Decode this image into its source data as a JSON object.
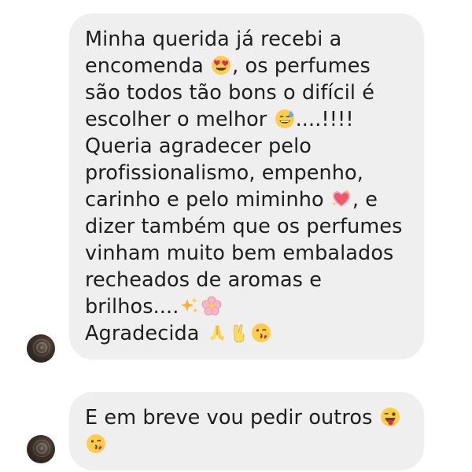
{
  "thread": {
    "messages": [
      {
        "lines": [
          [
            "Minha querida já recebi a"
          ],
          [
            "encomenda ",
            {
              "emoji": "heart-eyes-emoji"
            },
            ", os perfumes"
          ],
          [
            "são todos tão bons o difícil é"
          ],
          [
            "escolher o melhor ",
            {
              "emoji": "sweat-smile-emoji"
            },
            "....!!!!"
          ],
          [
            "Queria agradecer pelo"
          ],
          [
            "profissionalismo, empenho,"
          ],
          [
            "carinho e pelo miminho ",
            {
              "emoji": "sparkling-heart-emoji"
            },
            ", e"
          ],
          [
            "dizer também que os perfumes"
          ],
          [
            "vinham muito bem embalados"
          ],
          [
            "recheados de aromas e"
          ],
          [
            "brilhos....",
            {
              "emoji": "sparkles-emoji"
            },
            {
              "emoji": "cherry-blossom-emoji"
            }
          ],
          [
            "Agradecida ",
            {
              "emoji": "folded-hands-emoji"
            },
            {
              "emoji": "victory-hand-emoji"
            },
            {
              "emoji": "kissing-wink-emoji"
            }
          ]
        ]
      },
      {
        "lines": [
          [
            "E em breve vou pedir outros ",
            {
              "emoji": "winking-tongue-emoji"
            }
          ],
          [
            {
              "emoji": "kissing-wink-emoji"
            }
          ]
        ]
      }
    ]
  },
  "colors": {
    "bubble_background": "#efefef",
    "text": "#1d1d1d",
    "page_background": "#ffffff"
  }
}
